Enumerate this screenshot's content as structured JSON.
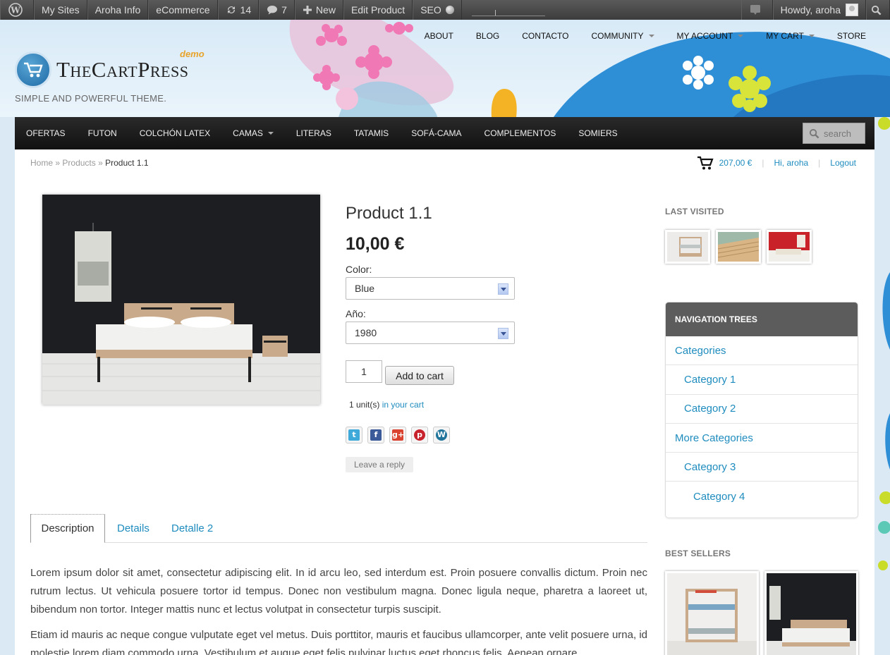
{
  "adminbar": {
    "my_sites": "My Sites",
    "site_name": "Aroha Info",
    "ecommerce": "eCommerce",
    "updates_count": "14",
    "comments_count": "7",
    "new_label": "New",
    "edit_product": "Edit Product",
    "seo": "SEO",
    "howdy": "Howdy, aroha"
  },
  "header": {
    "logo_text": "TheCartPress",
    "logo_badge": "demo",
    "tagline": "SIMPLE AND POWERFUL THEME.",
    "top_nav": [
      {
        "label": "ABOUT",
        "dropdown": false
      },
      {
        "label": "BLOG",
        "dropdown": false
      },
      {
        "label": "CONTACTO",
        "dropdown": false
      },
      {
        "label": "COMMUNITY",
        "dropdown": true
      },
      {
        "label": "MY ACCOUNT",
        "dropdown": true
      },
      {
        "label": "MY CART",
        "dropdown": true
      },
      {
        "label": "STORE",
        "dropdown": false
      }
    ]
  },
  "main_nav": {
    "items": [
      {
        "label": "OFERTAS",
        "dropdown": false
      },
      {
        "label": "FUTON",
        "dropdown": false
      },
      {
        "label": "COLCHÓN LATEX",
        "dropdown": false
      },
      {
        "label": "CAMAS",
        "dropdown": true
      },
      {
        "label": "LITERAS",
        "dropdown": false
      },
      {
        "label": "TATAMIS",
        "dropdown": false
      },
      {
        "label": "SOFÁ-CAMA",
        "dropdown": false
      },
      {
        "label": "COMPLEMENTOS",
        "dropdown": false
      },
      {
        "label": "SOMIERS",
        "dropdown": false
      }
    ],
    "search_placeholder": "search"
  },
  "breadcrumb": {
    "home": "Home",
    "sep": "»",
    "products": "Products",
    "current": "Product 1.1"
  },
  "cart_bar": {
    "total": "207,00 €",
    "greeting": "Hi, aroha",
    "logout": "Logout",
    "sep": "|"
  },
  "product": {
    "title": "Product 1.1",
    "price": "10,00 €",
    "color_label": "Color:",
    "color_value": "Blue",
    "year_label": "Año:",
    "year_value": "1980",
    "quantity": "1",
    "add_to_cart": "Add to cart",
    "units_prefix": "1 unit(s)",
    "units_link": "in your cart",
    "leave_reply": "Leave a reply"
  },
  "share_icons": [
    {
      "name": "twitter-icon",
      "glyph": "t",
      "color": "#3fa9d9"
    },
    {
      "name": "facebook-icon",
      "glyph": "f",
      "color": "#3b5a9a"
    },
    {
      "name": "google-plus-icon",
      "glyph": "g+",
      "color": "#d9432f"
    },
    {
      "name": "pinterest-icon",
      "glyph": "p",
      "color": "#c8232c"
    },
    {
      "name": "wordpress-icon",
      "glyph": "W",
      "color": "#21759b"
    }
  ],
  "tabs": [
    {
      "label": "Description",
      "active": true
    },
    {
      "label": "Details",
      "active": false
    },
    {
      "label": "Detalle 2",
      "active": false
    }
  ],
  "description": [
    "Lorem ipsum dolor sit amet, consectetur adipiscing elit. In id arcu leo, sed interdum est. Proin posuere convallis dictum. Proin nec rutrum lectus. Ut vehicula posuere tortor id tempus. Donec non vestibulum magna. Donec ligula neque, pharetra a laoreet ut, bibendum non tortor. Integer mattis nunc et lectus volutpat in consectetur turpis suscipit.",
    "Etiam id mauris ac neque congue vulputate eget vel metus. Duis porttitor, mauris et faucibus ullamcorper, ante velit posuere urna, id molestie lorem diam commodo urna. Vestibulum et augue eget felis pulvinar luctus eget rhoncus felis. Aenean ornare"
  ],
  "sidebar": {
    "last_visited_title": "LAST VISITED",
    "nav_trees_title": "NAVIGATION TREES",
    "nav_items": [
      {
        "label": "Categories",
        "level": 0
      },
      {
        "label": "Category 1",
        "level": 1
      },
      {
        "label": "Category 2",
        "level": 1
      },
      {
        "label": "More Categories",
        "level": 0
      },
      {
        "label": "Category 3",
        "level": 1
      },
      {
        "label": "Category 4",
        "level": 2
      }
    ],
    "best_sellers_title": "BEST SELLERS"
  },
  "colors": {
    "link": "#1e8cbe",
    "admin_bar": "#464646",
    "nav_bar": "#1a1a1a"
  }
}
